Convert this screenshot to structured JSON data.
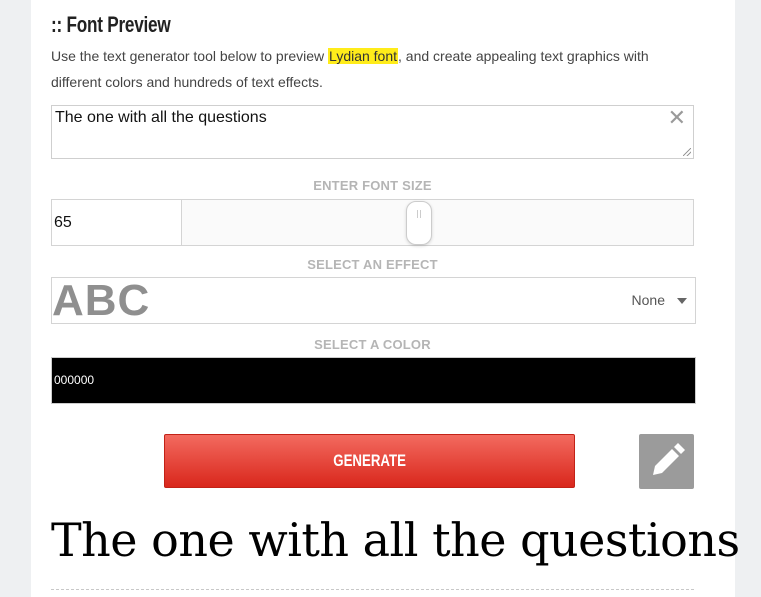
{
  "section": {
    "title": ":: Font Preview",
    "intro_before": "Use the text generator tool below to preview ",
    "intro_highlight": "Lydian font",
    "intro_after": ", and create appealing text graphics with different colors and hundreds of text effects."
  },
  "text_input": {
    "value": "The one with all the questions",
    "clear_glyph": "✕"
  },
  "font_size": {
    "label": "ENTER FONT SIZE",
    "value": "65"
  },
  "effect": {
    "label": "SELECT AN EFFECT",
    "sample": "ABC",
    "selected": "None"
  },
  "color": {
    "label": "SELECT A COLOR",
    "value": "000000",
    "swatch": "#000000"
  },
  "actions": {
    "generate_label": "GENERATE",
    "edit_icon": "pencil-icon"
  },
  "preview": {
    "text": "The one with all the questions"
  }
}
